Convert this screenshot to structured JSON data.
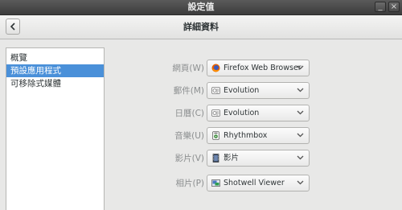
{
  "window": {
    "title": "設定值"
  },
  "header": {
    "title": "詳細資料",
    "back_icon": "chevron-left-icon"
  },
  "sidebar": {
    "items": [
      {
        "label": "概覽",
        "selected": false
      },
      {
        "label": "預設應用程式",
        "selected": true
      },
      {
        "label": "可移除式媒體",
        "selected": false
      }
    ]
  },
  "defaults": [
    {
      "label": "網頁(W)",
      "app": "Firefox Web Browser",
      "icon": "firefox-icon"
    },
    {
      "label": "郵件(M)",
      "app": "Evolution",
      "icon": "evolution-icon"
    },
    {
      "label": "日曆(C)",
      "app": "Evolution",
      "icon": "evolution-icon"
    },
    {
      "label": "音樂(U)",
      "app": "Rhythmbox",
      "icon": "rhythmbox-icon"
    },
    {
      "label": "影片(V)",
      "app": "影片",
      "icon": "video-icon"
    },
    {
      "label": "相片(P)",
      "app": "Shotwell Viewer",
      "icon": "shotwell-icon"
    }
  ],
  "colors": {
    "accent": "#4a90d9",
    "titlebar": "#3c3c3c",
    "background": "#e8e8e7"
  }
}
